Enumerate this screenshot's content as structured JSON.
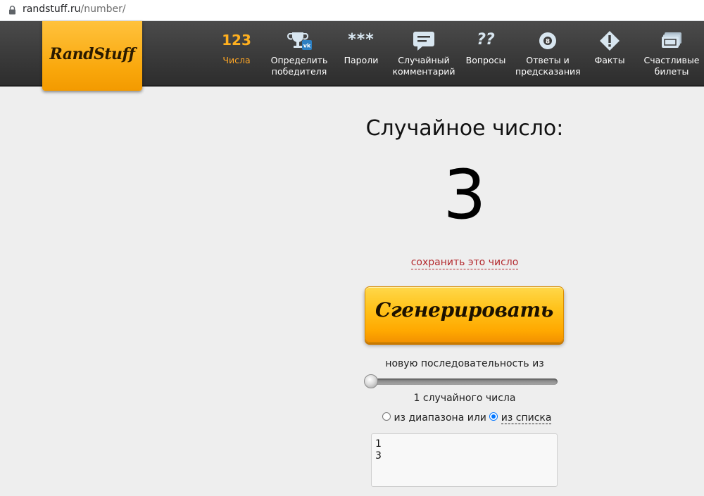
{
  "browser": {
    "url_host": "randstuff.ru",
    "url_path": "/number/"
  },
  "logo": {
    "text": "RandStuff",
    "color": "#f9a70b"
  },
  "nav": {
    "items": [
      {
        "label": "Числа",
        "icon": "numbers-123-icon",
        "icon_text": "123",
        "active": true
      },
      {
        "label": "Определить\nпобедителя",
        "icon": "trophy-vk-icon",
        "active": false
      },
      {
        "label": "Пароли",
        "icon": "password-stars-icon",
        "icon_text": "***",
        "active": false
      },
      {
        "label": "Случайный\nкомментарий",
        "icon": "comment-icon",
        "active": false
      },
      {
        "label": "Вопросы",
        "icon": "questions-icon",
        "icon_text": "??",
        "active": false
      },
      {
        "label": "Ответы и\nпредсказания",
        "icon": "magic-8-ball-icon",
        "active": false
      },
      {
        "label": "Факты",
        "icon": "exclamation-diamond-icon",
        "active": false
      },
      {
        "label": "Счастливые\nбилеты",
        "icon": "tickets-icon",
        "active": false
      }
    ],
    "active_color": "#ffa726"
  },
  "main": {
    "title": "Случайное число:",
    "number": "3",
    "save_link": "сохранить это число",
    "generate_button": "Сгенерировать",
    "sequence_text": "новую последовательность из",
    "slider_value": 1,
    "count_text": "1 случайного числа",
    "radio_range_label": "из диапазона или",
    "radio_list_label": "из списка",
    "selected_mode": "list",
    "list_value": "1\n3"
  }
}
